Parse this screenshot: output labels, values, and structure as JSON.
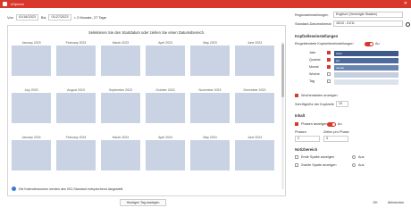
{
  "window": {
    "title": "eSpnem",
    "close": "✕"
  },
  "range": {
    "from_label": "Von",
    "from": "01/18/2023",
    "to_label": "Bis",
    "to": "01/27/2023",
    "duration": "= 2 Monate, 27 Tage"
  },
  "calendar": {
    "header": "Selektieren Sie den Startdatum oder ziehen Sie einen Datumsbereich.",
    "months": [
      "January 2023",
      "February 2023",
      "March 2023",
      "April 2023",
      "May 2023",
      "June 2023",
      "July 2023",
      "August 2023",
      "September 2023",
      "October 2023",
      "November 2023",
      "December 2023",
      "January 2024",
      "February 2024",
      "March 2024",
      "April 2024",
      "May 2024",
      "June 2024"
    ],
    "info": "Die Kalenderwochen werden den ISO-Standard entsprechend dargestellt.",
    "today_button": "Heutigen Tag anzeigen"
  },
  "settings": {
    "region_label": "Regionaleinstellungen",
    "region_value": "Englisch (Vereinigte Staaten)",
    "format_label": "Standard-Datumsformat",
    "format_value": "16/10 - 01/11",
    "header_section": "Kopfzeileneinstellungen",
    "header_toggle_label": "Eingeblendete Kopfzeileneinstellungen",
    "header_toggle_value": "An",
    "levels": [
      "Jahr",
      "Quartal",
      "Monat",
      "Woche",
      "Tag"
    ],
    "preview_bands": [
      "2024",
      "Q1",
      "Januar"
    ],
    "weeknum_label": "Wochentasten anzeigen",
    "font_label": "Schriftgröße der Kopfzeile",
    "font_value": "10",
    "content_section": "Inhalt",
    "phases_label": "Phasen anzeigen",
    "phases_value": "An",
    "phases_field": "Phasen",
    "phases_num": "2",
    "rows_field": "Zeilen pro Phase",
    "rows_num": "3",
    "notes_section": "Notizbereich",
    "notes1": "Erste Spalte anzeigen",
    "notes2": "Zweite Spalte anzeigen",
    "aus": "Aus",
    "ok": "OK",
    "cancel": "Abbrechen"
  },
  "colors": {
    "accent": "#d9372b",
    "calendar": "#c9d3e3",
    "band": "#3d5a8a"
  }
}
